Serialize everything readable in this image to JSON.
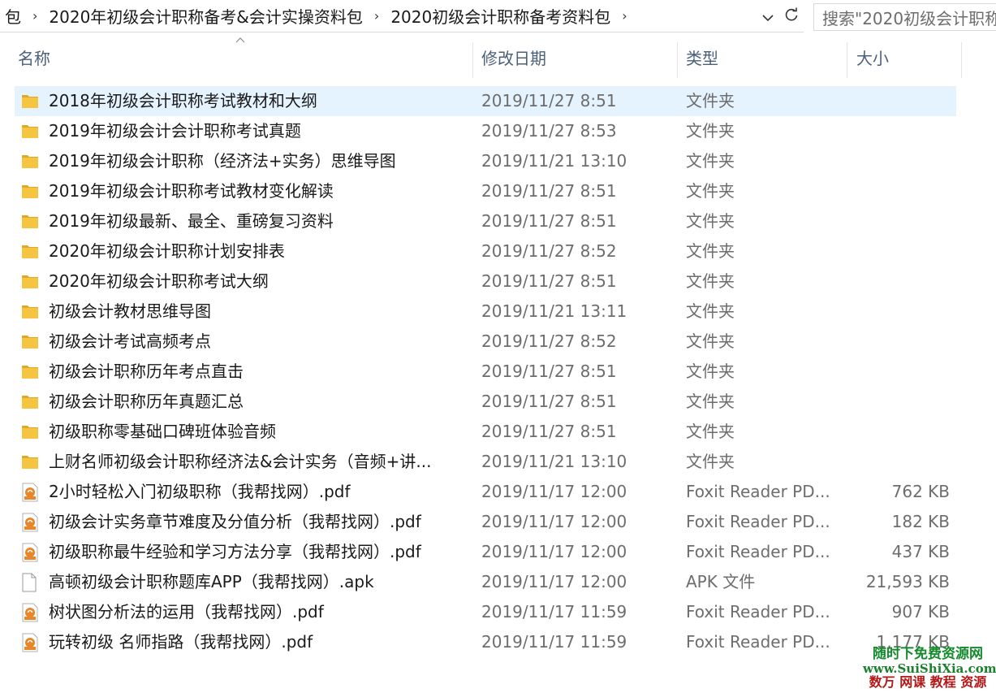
{
  "address_bar": {
    "crumbs": [
      "包",
      "2020年初级会计职称备考&会计实操资料包",
      "2020初级会计职称备考资料包"
    ],
    "separator": "›",
    "trailing_separator": "›",
    "dropdown_icon": "chevron-down-icon",
    "refresh_icon": "refresh-icon"
  },
  "search": {
    "placeholder": "搜索\"2020初级会计职称"
  },
  "columns": {
    "name": "名称",
    "date": "修改日期",
    "type": "类型",
    "size": "大小"
  },
  "files": [
    {
      "name": "2018年初级会计职称考试教材和大纲",
      "date": "2019/11/27 8:51",
      "type": "文件夹",
      "size": "",
      "icon": "folder-icon",
      "selected": true
    },
    {
      "name": "2019年初级会计会计职称考试真题",
      "date": "2019/11/27 8:53",
      "type": "文件夹",
      "size": "",
      "icon": "folder-icon"
    },
    {
      "name": "2019年初级会计职称（经济法+实务）思维导图",
      "date": "2019/11/21 13:10",
      "type": "文件夹",
      "size": "",
      "icon": "folder-icon"
    },
    {
      "name": "2019年初级会计职称考试教材变化解读",
      "date": "2019/11/27 8:51",
      "type": "文件夹",
      "size": "",
      "icon": "folder-icon"
    },
    {
      "name": "2019年初级最新、最全、重磅复习资料",
      "date": "2019/11/27 8:51",
      "type": "文件夹",
      "size": "",
      "icon": "folder-icon"
    },
    {
      "name": "2020年初级会计职称计划安排表",
      "date": "2019/11/27 8:52",
      "type": "文件夹",
      "size": "",
      "icon": "folder-icon"
    },
    {
      "name": "2020年初级会计职称考试大纲",
      "date": "2019/11/27 8:51",
      "type": "文件夹",
      "size": "",
      "icon": "folder-icon"
    },
    {
      "name": "初级会计教材思维导图",
      "date": "2019/11/21 13:11",
      "type": "文件夹",
      "size": "",
      "icon": "folder-icon"
    },
    {
      "name": "初级会计考试高频考点",
      "date": "2019/11/27 8:52",
      "type": "文件夹",
      "size": "",
      "icon": "folder-icon"
    },
    {
      "name": "初级会计职称历年考点直击",
      "date": "2019/11/27 8:51",
      "type": "文件夹",
      "size": "",
      "icon": "folder-icon"
    },
    {
      "name": "初级会计职称历年真题汇总",
      "date": "2019/11/27 8:51",
      "type": "文件夹",
      "size": "",
      "icon": "folder-icon"
    },
    {
      "name": "初级职称零基础口碑班体验音频",
      "date": "2019/11/27 8:51",
      "type": "文件夹",
      "size": "",
      "icon": "folder-icon"
    },
    {
      "name": "上财名师初级会计职称经济法&会计实务（音频+讲...",
      "date": "2019/11/21 13:10",
      "type": "文件夹",
      "size": "",
      "icon": "folder-icon"
    },
    {
      "name": "2小时轻松入门初级职称（我帮找网）.pdf",
      "date": "2019/11/17 12:00",
      "type": "Foxit Reader PD...",
      "size": "762 KB",
      "icon": "pdf-icon"
    },
    {
      "name": "初级会计实务章节难度及分值分析（我帮找网）.pdf",
      "date": "2019/11/17 12:00",
      "type": "Foxit Reader PD...",
      "size": "182 KB",
      "icon": "pdf-icon"
    },
    {
      "name": "初级职称最牛经验和学习方法分享（我帮找网）.pdf",
      "date": "2019/11/17 12:00",
      "type": "Foxit Reader PD...",
      "size": "437 KB",
      "icon": "pdf-icon"
    },
    {
      "name": "高顿初级会计职称题库APP（我帮找网）.apk",
      "date": "2019/11/17 12:00",
      "type": "APK 文件",
      "size": "21,593 KB",
      "icon": "file-icon"
    },
    {
      "name": "树状图分析法的运用（我帮找网）.pdf",
      "date": "2019/11/17 11:59",
      "type": "Foxit Reader PD...",
      "size": "907 KB",
      "icon": "pdf-icon"
    },
    {
      "name": "玩转初级 名师指路（我帮找网）.pdf",
      "date": "2019/11/17 11:59",
      "type": "Foxit Reader PD...",
      "size": "1,177 KB",
      "icon": "pdf-icon"
    }
  ],
  "watermark": {
    "line1": "随时下免费资源网",
    "line2": "www.SuiShiXia.com",
    "line3": "数万 网课 教程 资源"
  },
  "colors": {
    "selected_row": "#e5f3ff",
    "folder": "#f5c542",
    "pdf": "#e8862a",
    "header_text": "#4c607a"
  }
}
